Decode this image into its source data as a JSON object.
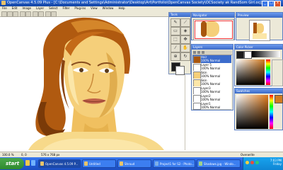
{
  "window": {
    "title": "OpenCanvas 4.5.09 Plus - [C:\\Documents and Settings\\Administrator\\Desktop\\Art\\Portfolio\\OpenCanvas Society\\OCSociety ak RandSom Girl.ocj]",
    "min_label": "_",
    "max_label": "□",
    "close_label": "x"
  },
  "menu": [
    "File",
    "Edit",
    "Image",
    "Layer",
    "Select",
    "Filter",
    "Plug-ins",
    "View",
    "Window",
    "Help"
  ],
  "panels": {
    "tools_title": "Tools",
    "navigator_title": "Navigator",
    "preview_title": "Preview",
    "layers_title": "Layers",
    "color_title": "Color Picker",
    "swatches_title": "Swatches"
  },
  "layers": [
    {
      "name": "Hair",
      "blend": "100% Normal",
      "selected": true
    },
    {
      "name": "Layer 5",
      "blend": "100% Normal",
      "selected": false
    },
    {
      "name": "Skin",
      "blend": "100% Normal",
      "selected": false
    },
    {
      "name": "Skin",
      "blend": "100% Normal",
      "selected": false
    },
    {
      "name": "Layer3",
      "blend": "100% Normal",
      "selected": false
    },
    {
      "name": "Layer2",
      "blend": "100% Normal",
      "selected": false
    },
    {
      "name": "Layer1",
      "blend": "100% Normal",
      "selected": false
    },
    {
      "name": "Layer 1",
      "blend": "100% Normal",
      "selected": false
    }
  ],
  "status": {
    "zoom": "100.0 %",
    "position": "0, 0",
    "size": "576 x 768 px",
    "mode": "Overwrite"
  },
  "taskbar": {
    "start_label": "start",
    "items": [
      {
        "label": "OpenCanvas 4.5.09 P...",
        "active": true
      },
      {
        "label": "Untitled",
        "active": false
      },
      {
        "label": "Shroud",
        "active": false
      },
      {
        "label": "Project1 for S2 - Photo...",
        "active": false
      },
      {
        "label": "Shadows.jpg - Windo...",
        "active": false
      }
    ],
    "time": "7:03 PM",
    "day": "Friday"
  },
  "colors": {
    "titlebar": "#1a4fb3",
    "skin": "#f5cf7a",
    "skin_light": "#fbe6a8",
    "skin_shadow": "#e0ad4e",
    "hair": "#a8560e",
    "hair_dark": "#6b3208",
    "primary_color": "#1c1c1c",
    "secondary_color": "#ffffff",
    "picked_color": "#d27a1f"
  }
}
